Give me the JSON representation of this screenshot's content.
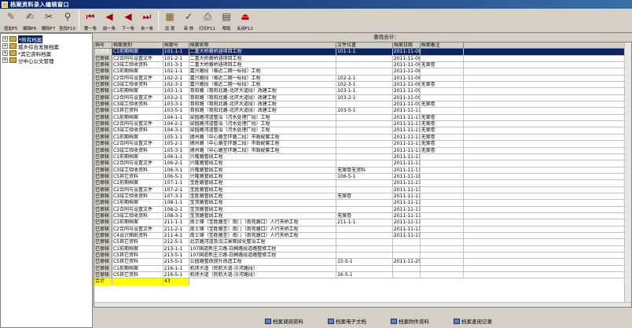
{
  "window": {
    "title": "档案资料录入编辑窗口"
  },
  "toolbar": [
    {
      "label": "增加F5",
      "icon": "add-icon",
      "glyph": "✎",
      "color": "#806020"
    },
    {
      "label": "编辑F6",
      "icon": "edit-icon",
      "glyph": "✍",
      "color": "#404040"
    },
    {
      "label": "删除F7",
      "icon": "delete-icon",
      "glyph": "✂",
      "color": "#404040"
    },
    {
      "label": "查找F10",
      "icon": "find-icon",
      "glyph": "⚲",
      "color": "#404040"
    },
    {
      "label": "第一条",
      "icon": "first-record-icon",
      "glyph": "⏮",
      "color": "#a00000"
    },
    {
      "label": "前一条",
      "icon": "prev-record-icon",
      "glyph": "◀",
      "color": "#a00000"
    },
    {
      "label": "下一条",
      "icon": "next-record-icon",
      "glyph": "◀",
      "color": "#a00000"
    },
    {
      "label": "末一条",
      "icon": "last-record-icon",
      "glyph": "⏭",
      "color": "#a00000"
    },
    {
      "label": "设 置",
      "icon": "settings-icon",
      "glyph": "▦",
      "color": "#806020"
    },
    {
      "label": "审 核",
      "icon": "audit-icon",
      "glyph": "✓",
      "color": "#404040"
    },
    {
      "label": "打印F11",
      "icon": "print-icon",
      "glyph": "⎙",
      "color": "#404040"
    },
    {
      "label": "帮助",
      "icon": "help-icon",
      "glyph": "▤",
      "color": "#404040"
    },
    {
      "label": "关闭F12",
      "icon": "close-icon",
      "glyph": "⏏",
      "color": "#c00000"
    }
  ],
  "tree": [
    {
      "label": "*所有档案",
      "selected": true
    },
    {
      "label": "城乡综合发展档案",
      "selected": false
    },
    {
      "label": "*其它资料档案",
      "selected": false
    },
    {
      "label": "分中心公文管理",
      "selected": false
    }
  ],
  "summary": "查找合计：",
  "columns": [
    "档号",
    "档案类别",
    "档案号",
    "档案名称",
    "文件位置",
    "档案日期",
    "档案备注"
  ],
  "rows": [
    [
      "已审核",
      "C1前期档案",
      "101-1-1",
      "二重大桥路桥涵项目工程",
      "101-1-1",
      "2011-11-08",
      ""
    ],
    [
      "已审核",
      "C2合同与设置文件",
      "101-2-1",
      "二重大桥路桥涵项目工程",
      "",
      "2011-11-08",
      ""
    ],
    [
      "已审核",
      "C3竣工验收资料",
      "101-3-1",
      "二重大桥路桥涵项目工程",
      "",
      "2011-11-08",
      "无案卷"
    ],
    [
      "已审核",
      "C1前期档案",
      "102-1-1",
      "嘉兴路段（临近二期一标段）工程",
      "",
      "2011-11-08",
      ""
    ],
    [
      "已审核",
      "C2合同与设置文件",
      "102-2-1",
      "嘉兴路段（临近二期一标段）工程",
      "102-2-1",
      "2011-11-08",
      ""
    ],
    [
      "已审核",
      "C3竣工验收资料",
      "102-3-1",
      "嘉兴路段（临近二期一标段）工程",
      "102-3-1",
      "2011-11-08",
      "无案卷"
    ],
    [
      "已审核",
      "C1前期档案",
      "103-1-1",
      "育阳路（育阳北路-北环大道段）改建工程",
      "103-1-1",
      "2011-11-09",
      ""
    ],
    [
      "已审核",
      "C2合同与设置文件",
      "103-2-1",
      "育阳路（育阳北路-北环大道段）改建工程",
      "103-2-1",
      "2011-11-09",
      ""
    ],
    [
      "已审核",
      "C3竣工验收资料",
      "103-3-1",
      "育阳路（育阳北路-北环大道段）改建工程",
      "",
      "2011-11-09",
      "无案卷"
    ],
    [
      "已审核",
      "C5其它资料",
      "103-5-1",
      "育阳路（育阳北路-北环大道段）改建工程",
      "103-5-1",
      "2011-11-11",
      ""
    ],
    [
      "已审核",
      "C1前期档案",
      "104-1-1",
      "梁园路河道整治（污水处理厂段）工程",
      "",
      "2011-11-11",
      "无案卷"
    ],
    [
      "已审核",
      "C2合同与设置文件",
      "104-2-1",
      "梁园路河道整治（污水处理厂段）工程",
      "",
      "2011-11-11",
      "无案卷"
    ],
    [
      "已审核",
      "C3竣工验收资料",
      "104-3-1",
      "梁园路河道整治（污水处理厂段）工程",
      "",
      "2011-11-11",
      "无案卷"
    ],
    [
      "已审核",
      "C1前期档案",
      "105-1-1",
      "德州路（中心路至环路二段）市政配套工程",
      "",
      "2011-11-11",
      "无案卷"
    ],
    [
      "已审核",
      "C2合同与设置文件",
      "105-2-1",
      "德州路（中心路至环路二段）市政配套工程",
      "",
      "2011-11-11",
      "无案卷"
    ],
    [
      "已审核",
      "C3竣工验收资料",
      "105-3-1",
      "德州路（中心路至环路二段）市政配套工程",
      "",
      "2011-11-11",
      "无案卷"
    ],
    [
      "已审核",
      "C1前期档案",
      "106-1-1",
      "兴隆路管线工程",
      "",
      "2011-11-11",
      ""
    ],
    [
      "已审核",
      "C2合同与设置文件",
      "106-2-1",
      "兴隆路管线工程",
      "",
      "2011-11-11",
      ""
    ],
    [
      "已审核",
      "C3竣工验收资料",
      "106-3-1",
      "兴隆路管线工程",
      "无案卷无资料",
      "2011-11-11",
      ""
    ],
    [
      "已审核",
      "C5其它资料",
      "106-5-1",
      "兴隆路管线工程",
      "106-5-1",
      "2011-11-18",
      ""
    ],
    [
      "已审核",
      "C1前期档案",
      "107-1-1",
      "宝胜路管线工程",
      "",
      "2011-11-11",
      ""
    ],
    [
      "已审核",
      "C2合同与设置文件",
      "107-2-1",
      "宝胜路管线工程",
      "",
      "2011-11-11",
      ""
    ],
    [
      "已审核",
      "C3竣工验收资料",
      "107-3-1",
      "宝胜路管线工程",
      "无案卷",
      "2011-11-11",
      ""
    ],
    [
      "已审核",
      "C1前期档案",
      "108-1-1",
      "宝顶路管线工程",
      "",
      "2011-11-11",
      ""
    ],
    [
      "已审核",
      "C2合同与设置文件",
      "108-2-1",
      "宝顶路管线工程",
      "",
      "2011-11-11",
      ""
    ],
    [
      "已审核",
      "C3竣工验收资料",
      "108-3-1",
      "宝顶路管线工程",
      "无案卷",
      "2011-11-11",
      ""
    ],
    [
      "已审核",
      "C1前期档案",
      "211-1-1",
      "南士铺（宝胜路至）南门（南苑路口）人行天桥工程",
      "211-1-1",
      "2011-11-11",
      ""
    ],
    [
      "已审核",
      "C2合同与设置文件",
      "211-2-1",
      "南士铺（宝胜路至）南门（南苑路口）人行天桥工程",
      "",
      "2011-11-11",
      ""
    ],
    [
      "已审核",
      "C4设计图纸资料",
      "211-4-1",
      "南士铺（宝胜路至）南门（南苑路口）人行天桥工程",
      "",
      "2011-11-11",
      ""
    ],
    [
      "已审核",
      "C5其它资料",
      "212-5-1",
      "北京路河道及沿江景观绿化整治工程",
      "",
      "",
      ""
    ],
    [
      "已审核",
      "C1前期档案",
      "213-1-1",
      "107国道新庄三路-白桐路段道路整修工程",
      "",
      "",
      ""
    ],
    [
      "已审核",
      "C5其它资料",
      "213-5-1",
      "107国道新庄三路-白桐路段道路整修工程",
      "",
      "",
      ""
    ],
    [
      "已审核",
      "C5其它资料",
      "215-5-1",
      "公园路整改提升改造工程",
      "15-5-1",
      "2011-11-25",
      ""
    ],
    [
      "已审核",
      "C1前期档案",
      "216-1-1",
      "机场大道（民航大道-沙河路段）",
      "",
      "",
      ""
    ],
    [
      "已审核",
      "C5其它资料",
      "216-5-1",
      "机场大道（民航大道-沙河路段）",
      "16-5-1",
      "",
      ""
    ]
  ],
  "footer": {
    "label": "合计",
    "count": "43"
  },
  "bottom_buttons": [
    {
      "label": "档案调阅资料",
      "icon": "borrow-icon"
    },
    {
      "label": "档案电子文档",
      "icon": "edoc-icon"
    },
    {
      "label": "档案附件资料",
      "icon": "attachment-icon"
    },
    {
      "label": "档案查阅记录",
      "icon": "log-icon"
    }
  ],
  "colors": {
    "selection": "#0a246a",
    "footer": "#ffff00",
    "chrome": "#d4d0c8"
  }
}
